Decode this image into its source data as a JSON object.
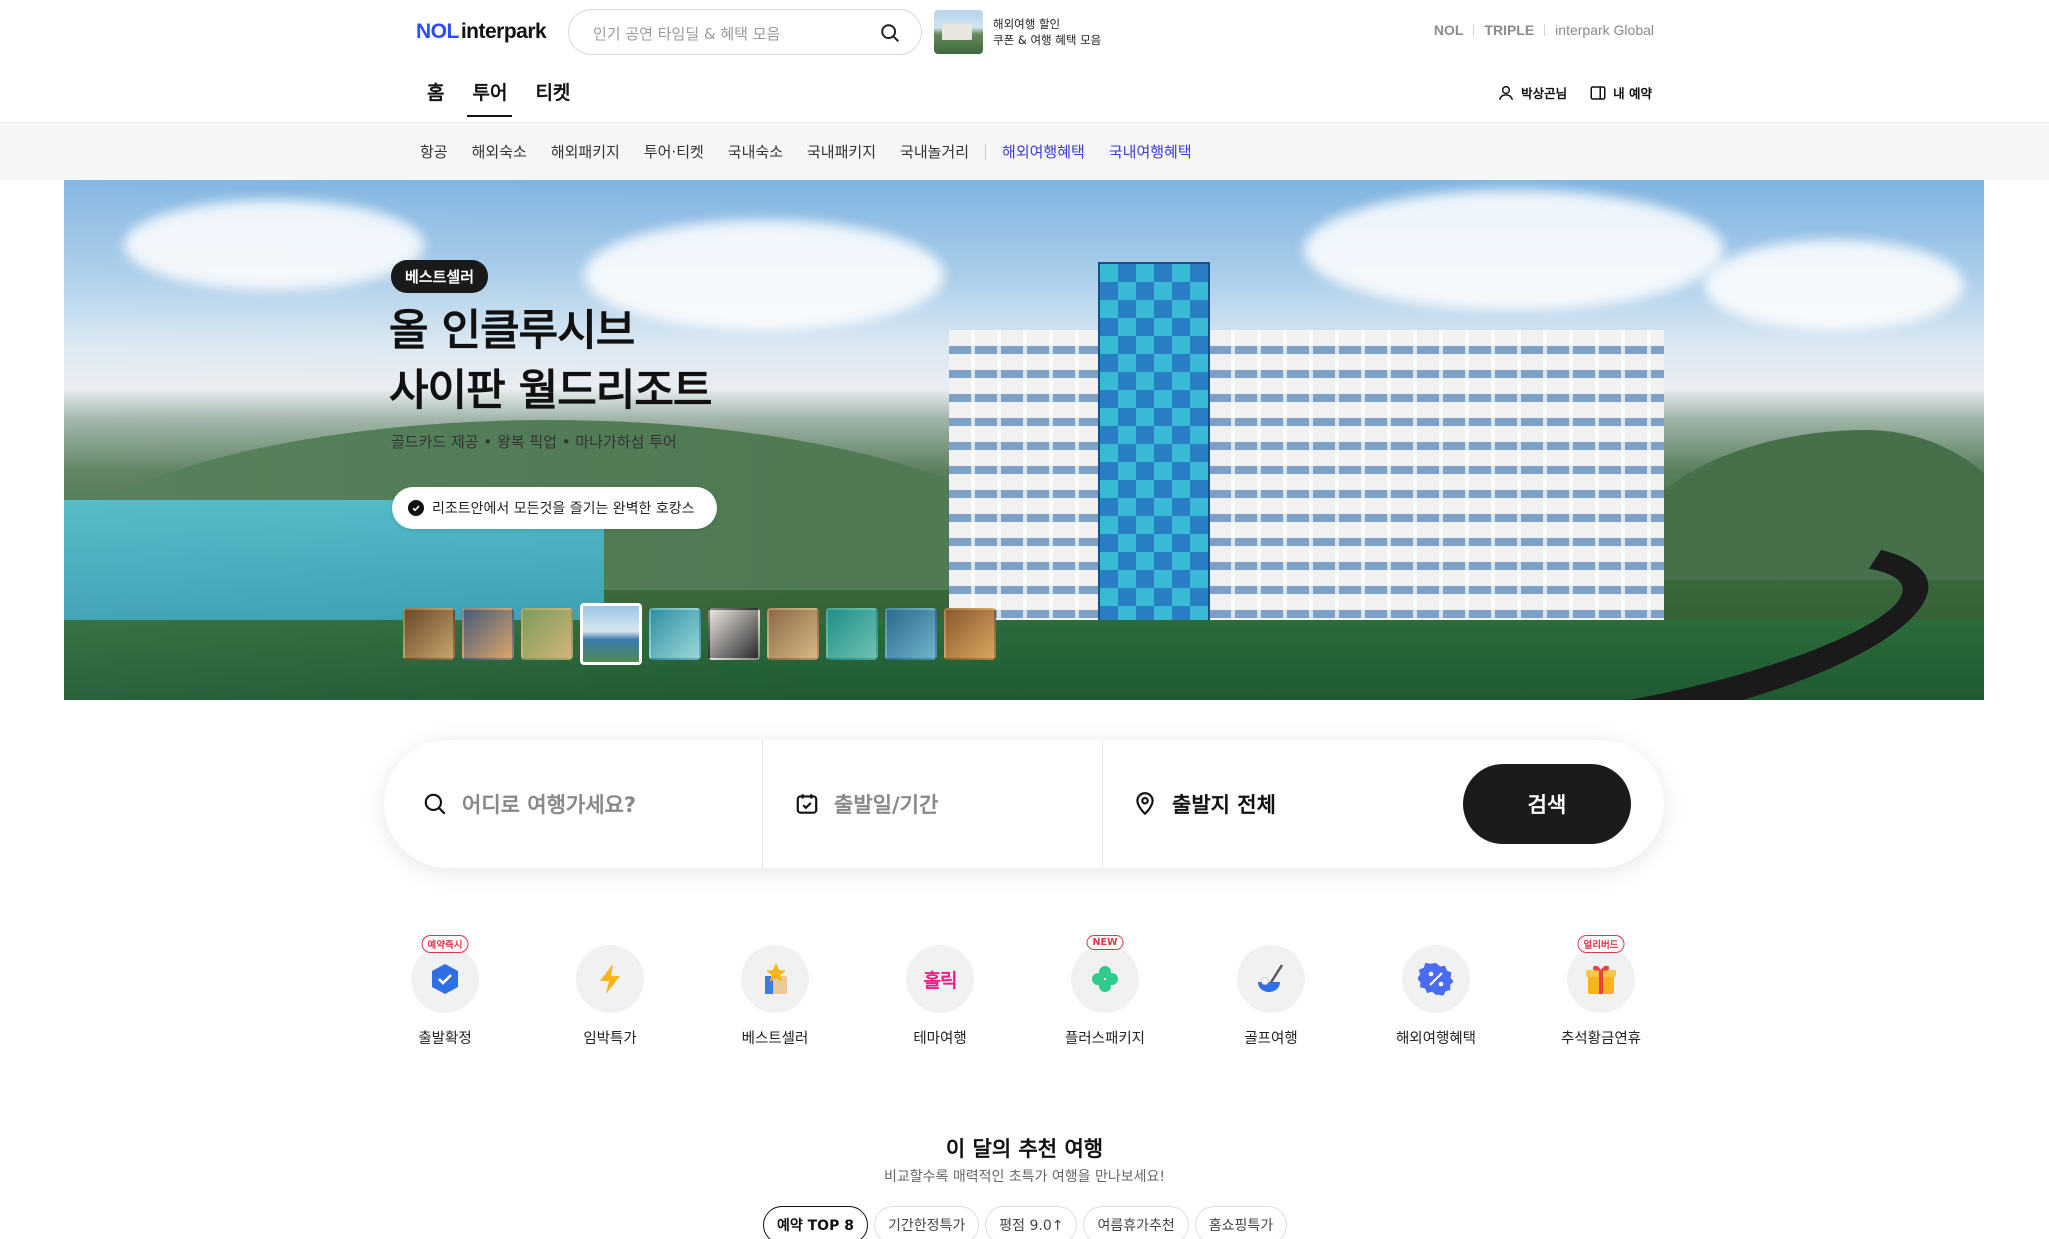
{
  "header": {
    "logo_nol": "NOL",
    "logo_interpark": "interpark",
    "search_placeholder": "인기 공연 타임딜 & 혜택 모음",
    "promo_line1": "해외여행 할인",
    "promo_line2": "쿠폰 & 여행 혜택 모음",
    "brands": [
      "NOL",
      "TRIPLE",
      "interpark Global"
    ]
  },
  "main_tabs": [
    {
      "label": "홈",
      "active": false
    },
    {
      "label": "투어",
      "active": true
    },
    {
      "label": "티켓",
      "active": false
    }
  ],
  "user": {
    "name": "박상곤님",
    "reservation": "내 예약"
  },
  "subnav": {
    "items": [
      "항공",
      "해외숙소",
      "해외패키지",
      "투어·티켓",
      "국내숙소",
      "국내패키지",
      "국내놀거리"
    ],
    "highlight_items": [
      "해외여행혜택",
      "국내여행혜택"
    ],
    "highlight_color": "#3a3ad8"
  },
  "hero": {
    "badge": "베스트셀러",
    "title_line1": "올 인클루시브",
    "title_line2": "사이판 월드리조트",
    "subtitle": "골드카드 제공 • 왕복 픽업 • 마나가하섬 투어",
    "chip": "리조트안에서 모든것을 즐기는 완벽한 호캉스",
    "thumbnail_count": 10,
    "active_thumbnail": 4
  },
  "search_bar": {
    "destination_placeholder": "어디로 여행가세요?",
    "date_placeholder": "출발일/기간",
    "departure": "출발지 전체",
    "button": "검색"
  },
  "categories": [
    {
      "label": "출발확정",
      "tag": "예약즉시",
      "icon": "shield-check-icon"
    },
    {
      "label": "임박특가",
      "tag": "",
      "icon": "lightning-icon"
    },
    {
      "label": "베스트셀러",
      "tag": "",
      "icon": "star-box-icon"
    },
    {
      "label": "테마여행",
      "tag": "",
      "icon": "theme-text-icon",
      "icon_text": "홀릭"
    },
    {
      "label": "플러스패키지",
      "tag": "NEW",
      "icon": "clover-icon"
    },
    {
      "label": "골프여행",
      "tag": "",
      "icon": "golf-icon"
    },
    {
      "label": "해외여행혜택",
      "tag": "",
      "icon": "percent-badge-icon"
    },
    {
      "label": "추석황금연휴",
      "tag": "얼리버드",
      "icon": "gift-icon"
    }
  ],
  "recommendation": {
    "title": "이 달의 추천 여행",
    "subtitle": "비교할수록 매력적인 초특가 여행을 만나보세요!",
    "pills": [
      {
        "label": "예약 TOP 8",
        "active": true
      },
      {
        "label": "기간한정특가",
        "active": false
      },
      {
        "label": "평점 9.0↑",
        "active": false
      },
      {
        "label": "여름휴가추천",
        "active": false
      },
      {
        "label": "홈쇼핑특가",
        "active": false
      }
    ]
  }
}
